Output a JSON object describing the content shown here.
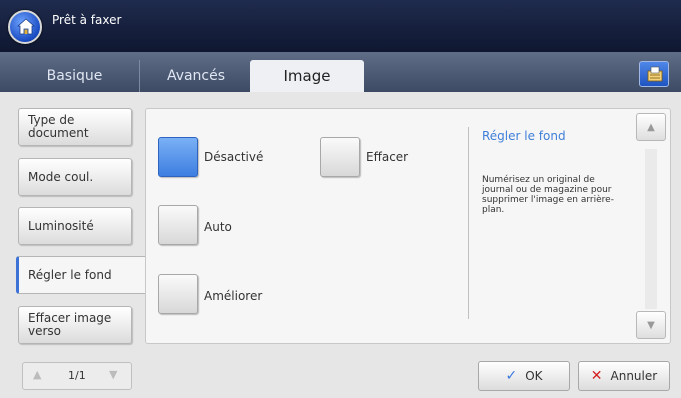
{
  "header": {
    "title": "Prêt à faxer"
  },
  "tabs": [
    {
      "label": "Basique"
    },
    {
      "label": "Avancés"
    },
    {
      "label": "Image"
    }
  ],
  "left_menu": [
    {
      "label": "Type de document"
    },
    {
      "label": "Mode coul."
    },
    {
      "label": "Luminosité"
    },
    {
      "label": "Régler le fond",
      "active": true
    },
    {
      "label": "Effacer image verso"
    }
  ],
  "options": {
    "desactive": "Désactivé",
    "auto": "Auto",
    "ameliorer": "Améliorer",
    "effacer": "Effacer",
    "selected": "Désactivé"
  },
  "help": {
    "title": "Régler le fond",
    "text": "Numérisez un original de journal ou de magazine pour supprimer l'image en arrière-plan."
  },
  "pager": {
    "text": "1/1"
  },
  "buttons": {
    "ok": "OK",
    "cancel": "Annuler"
  },
  "colors": {
    "accent": "#3d73d6",
    "header": "#1f2b4e",
    "help_title": "#3f7fd8",
    "cancel": "#d42020"
  },
  "icons": {
    "home": "home-icon",
    "tab_right": "job-status-icon",
    "ok": "check-icon",
    "cancel": "close-icon",
    "scroll_up": "triangle-up-icon",
    "scroll_down": "triangle-down-icon"
  }
}
